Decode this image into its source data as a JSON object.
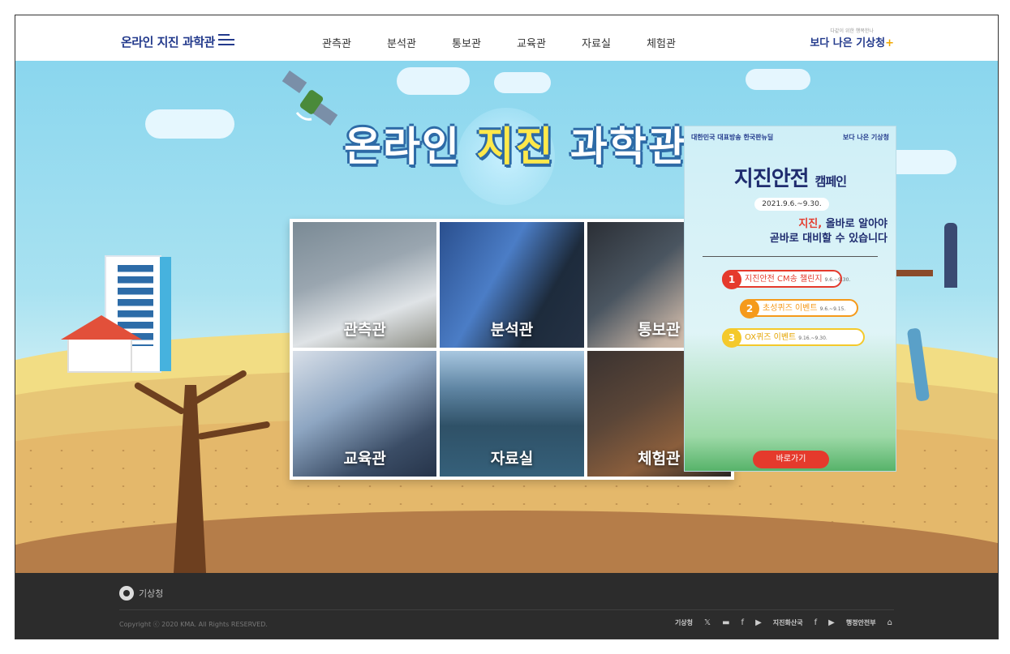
{
  "header": {
    "logo": "온라인 지진 과학관",
    "menu_icon": "hamburger-menu-icon",
    "nav": [
      "관측관",
      "분석관",
      "통보관",
      "교육관",
      "자료실",
      "체험관"
    ],
    "brand_small": "다같이 위한 행복한나",
    "brand": "보다 나은 기상청"
  },
  "hero": {
    "title_pre": "온라인 ",
    "title_hl": "지진",
    "title_post": " 과학관"
  },
  "tiles": [
    "관측관",
    "분석관",
    "통보관",
    "교육관",
    "자료실",
    "체험관"
  ],
  "popup": {
    "org_left": "대한민국 대표방송 한국판뉴딜",
    "org_right": "보다 나은 기상청",
    "title_main": "지진안전",
    "title_sub": "캠페인",
    "date": "2021.9.6.~9.30.",
    "slogan_hl": "지진,",
    "slogan_1": " 올바로 알아야",
    "slogan_2": "곧바로 대비할 수 있습니다",
    "events": [
      {
        "num": "1",
        "label": "지진안전 CM송 챌린지",
        "date": "9.6.~9.30.",
        "color": "#e53a2c"
      },
      {
        "num": "2",
        "label": "초성퀴즈 이벤트",
        "date": "9.6.~9.15.",
        "color": "#f59a1b"
      },
      {
        "num": "3",
        "label": "OX퀴즈 이벤트",
        "date": "9.16.~9.30.",
        "color": "#f4c92b"
      }
    ],
    "button": "바로가기"
  },
  "footer": {
    "logo": "기상청",
    "copyright": "Copyright ⓒ 2020 KMA. All Rights RESERVED.",
    "links": [
      {
        "label": "기상청",
        "icons": [
          "twitter-icon",
          "chat-icon",
          "facebook-icon",
          "youtube-icon"
        ]
      },
      {
        "label": "지진화산국",
        "icons": [
          "facebook-icon",
          "youtube-icon"
        ]
      },
      {
        "label": "행정안전부",
        "icons": [
          "home-icon"
        ]
      }
    ]
  },
  "colors": {
    "accent": "#233a8c",
    "popup_red": "#e53a2c",
    "footer_bg": "#2c2c2c"
  }
}
